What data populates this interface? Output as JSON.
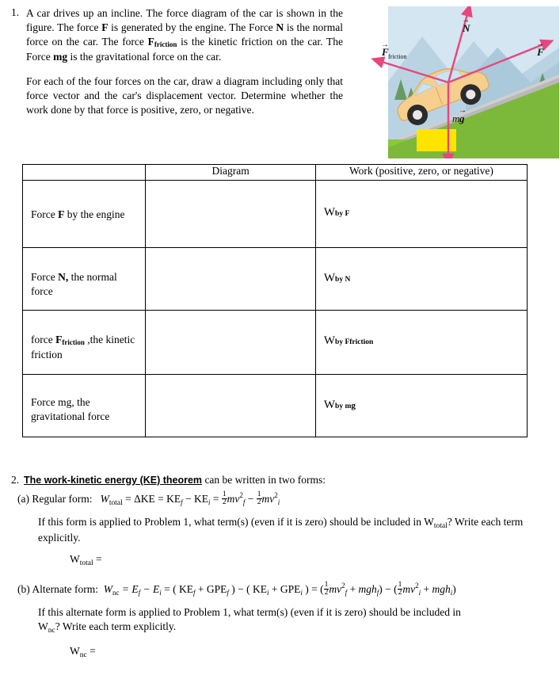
{
  "problem1": {
    "number": "1.",
    "para1_part1": "A car drives up an incline. The force diagram of the car is shown in the figure. The force ",
    "para1_F": "F",
    "para1_part2": " is generated by the engine. The Force ",
    "para1_N": "N",
    "para1_part3": " is the normal force on the car. The force ",
    "para1_Ffric": "F",
    "para1_Ffric_sub": "friction",
    "para1_part4": " is the kinetic friction on the car. The Force ",
    "para1_mg": "mg",
    "para1_part5": " is the gravitational force on the car.",
    "para2": "For each of the four forces on the car, draw a diagram including only that force vector and the car's displacement vector. Determine whether the work done by that force is positive, zero, or negative."
  },
  "figure": {
    "label_N": "N",
    "label_F": "F",
    "label_Ffriction": "F",
    "label_Ffriction_sub": "friction",
    "label_mg": "mg",
    "arrow_color": "#e8467c",
    "car_color": "#f5c886",
    "ground_color": "#8dc63f",
    "sky_color": "#cfe3ef"
  },
  "table": {
    "headers": [
      "",
      "Diagram",
      "Work (positive, zero, or negative)"
    ],
    "rows": [
      {
        "force_prefix": "Force ",
        "force_symbol": "F",
        "force_suffix": " by the engine",
        "force_sub": "",
        "work_label": "W",
        "work_sub": "by F"
      },
      {
        "force_prefix": "Force ",
        "force_symbol": "N,",
        "force_suffix": " the normal force",
        "force_sub": "",
        "work_label": "W",
        "work_sub": "by N"
      },
      {
        "force_prefix": "force ",
        "force_symbol": "F",
        "force_sub": "friction",
        "force_suffix": " ,the kinetic friction",
        "work_label": "W",
        "work_sub": "by Ffriction"
      },
      {
        "force_prefix": "Force ",
        "force_symbol": "mg,",
        "force_suffix": " the gravitational force",
        "force_sub": "",
        "work_label": "W",
        "work_sub_a": "by m",
        "work_sub_b": "g"
      }
    ]
  },
  "problem2": {
    "number": "2.",
    "title_underlined": "The work-kinetic energy (KE) theorem",
    "title_rest": " can be written in two forms:",
    "part_a_label": "(a) Regular form:",
    "part_a_W": "W",
    "part_a_W_sub": "total",
    "part_a_eq": "= ΔKE = KE",
    "part_a_f": "f",
    "part_a_minus": " − KE",
    "part_a_i": "i",
    "part_a_eq2": " =",
    "part_a_tail1": "mv",
    "part_a_tail1_sup": "2",
    "part_a_tail1_sub": "f",
    "part_a_tail2": "mv",
    "part_a_tail2_sup": "2",
    "part_a_tail2_sub": "i",
    "q_a": "If this form is applied to Problem 1, what term(s) (even if it is zero) should be included in W",
    "q_a_sub": "total",
    "q_a_end": "? Write each term explicitly.",
    "answer_a_label": "W",
    "answer_a_sub": "total",
    "answer_a_eq": " =",
    "part_b_label": "(b) Alternate form:",
    "part_b_expr_W": "W",
    "part_b_expr_W_sub": "nc",
    "part_b_expr": " = E",
    "part_b_f": "f",
    "part_b_minus": " − E",
    "part_b_i": "i",
    "part_b_eq": " = ( KE",
    "part_b_grp1_f": "f",
    "part_b_grp1_plus": " + GPE",
    "part_b_grp1_f2": "f",
    "part_b_grp1_close": " ) − ( KE",
    "part_b_grp2_i": "i",
    "part_b_grp2_plus": " + GPE",
    "part_b_grp2_i2": "i",
    "part_b_grp2_close": " ) =",
    "part_b_tail_m1": "mv",
    "part_b_tail_m1_sup": "2",
    "part_b_tail_m1_sub": "f",
    "part_b_tail_mgh_f": "mgh",
    "part_b_tail_mgh_f_sub": "f",
    "part_b_tail_m2": "mv",
    "part_b_tail_m2_sup": "2",
    "part_b_tail_m2_sub": "i",
    "part_b_tail_mgh_i": "mgh",
    "part_b_tail_mgh_i_sub": "i",
    "q_b_line1": "If this alternate form is applied to Problem 1, what term(s) (even if it is zero) should be included in",
    "q_b_line2_W": "W",
    "q_b_line2_sub": "nc",
    "q_b_line2_rest": "? Write each term explicitly.",
    "answer_b_label": "W",
    "answer_b_sub": "nc",
    "answer_b_eq": " ="
  }
}
